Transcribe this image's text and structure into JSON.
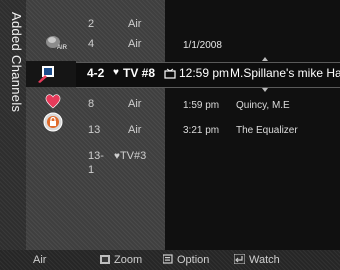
{
  "side_title": "Added Channels",
  "channels": [
    {
      "number": "2",
      "name": "Air",
      "favorite": false
    },
    {
      "number": "4",
      "name": "Air",
      "favorite": false
    },
    {
      "number": "8",
      "name": "Air",
      "favorite": false
    },
    {
      "number": "13",
      "name": "Air",
      "favorite": false
    },
    {
      "number": "13-1",
      "name": "TV#3",
      "favorite": true
    }
  ],
  "highlighted": {
    "number": "4-2",
    "heart": "♥",
    "name": "TV #8",
    "program_time": "12:59 pm",
    "program_title": "M.Spillane's mike Ha.."
  },
  "guide": {
    "date": "1/1/2008",
    "programs": [
      {
        "time": "1:59 pm",
        "title": "Quincy, M.E"
      },
      {
        "time": "3:21 pm",
        "title": "The Equalizer"
      }
    ]
  },
  "icons": {
    "air": "air-antenna-icon",
    "edit": "edit-channel-icon",
    "favorite": "heart-icon",
    "lock": "lock-icon"
  },
  "bottom_bar": {
    "source": "Air",
    "zoom_label": "Zoom",
    "option_label": "Option",
    "watch_label": "Watch"
  },
  "colors": {
    "heart": "#e63a5a",
    "panel": "#101010",
    "background": "#3f3f3f"
  }
}
